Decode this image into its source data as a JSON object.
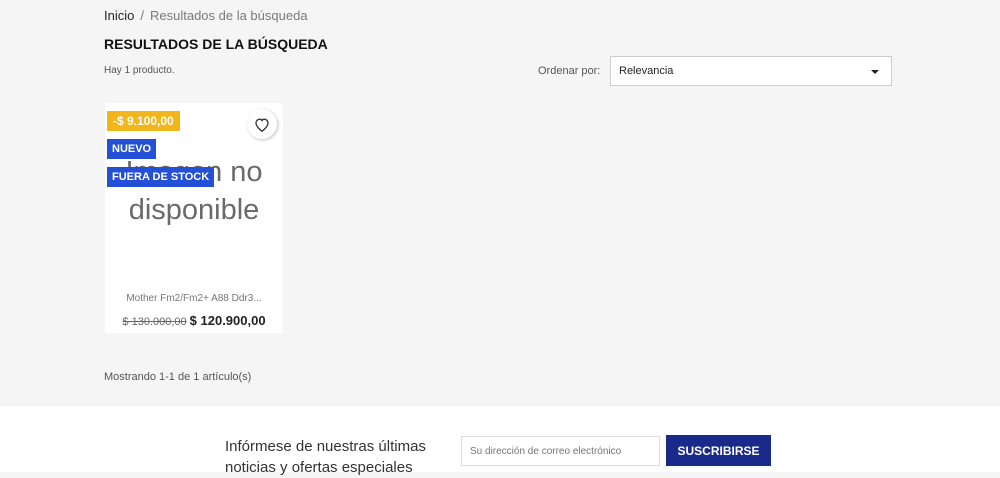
{
  "breadcrumb": {
    "home": "Inicio",
    "separator": "/",
    "current": "Resultados de la búsqueda"
  },
  "page_title": "RESULTADOS DE LA BÚSQUEDA",
  "product_count": "Hay 1 producto.",
  "sort": {
    "label": "Ordenar por:",
    "selected": "Relevancia"
  },
  "product": {
    "discount": "-$ 9.100,00",
    "badge_new": "NUEVO",
    "badge_stock": "FUERA DE STOCK",
    "image_text_1": "Imagen no",
    "image_text_2": "disponible",
    "name": "Mother Fm2/Fm2+ A88 Ddr3...",
    "old_price": "$ 130.000,00",
    "price": "$ 120.900,00"
  },
  "pagination": "Mostrando 1-1 de 1 artículo(s)",
  "newsletter": {
    "line1": "Infórmese de nuestras últimas",
    "line2": "noticias y ofertas especiales",
    "placeholder": "Su dirección de correo electrónico",
    "button": "SUSCRIBIRSE"
  }
}
